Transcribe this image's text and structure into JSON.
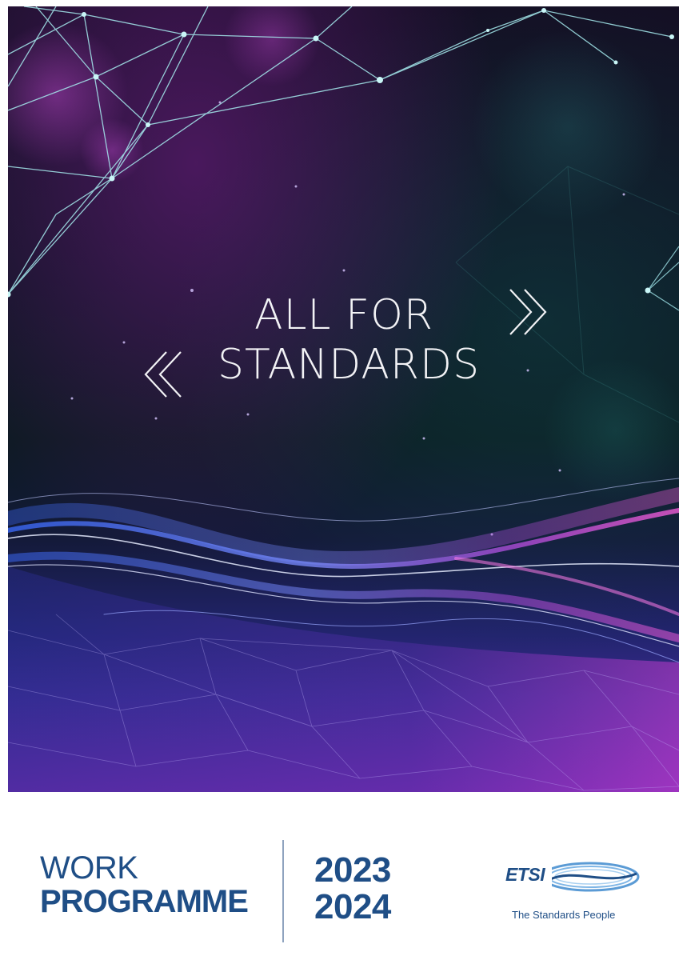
{
  "cover": {
    "headline_line1": "ALL FOR",
    "headline_line2": "STANDARDS",
    "chevron_right_icon": "double-chevron-right",
    "chevron_left_icon": "double-chevron-left"
  },
  "footer": {
    "title_line1": "WORK",
    "title_line2": "PROGRAMME",
    "year_line1": "2023",
    "year_line2": "2024",
    "logo_text": "ETSI",
    "logo_tagline": "The Standards People"
  },
  "colors": {
    "brand_blue": "#1f4e86",
    "headline_text": "#f2f2f5",
    "network_lines": "#9fe3e8",
    "wave_magenta": "#c03fd8",
    "wave_blue": "#4a63e8"
  }
}
